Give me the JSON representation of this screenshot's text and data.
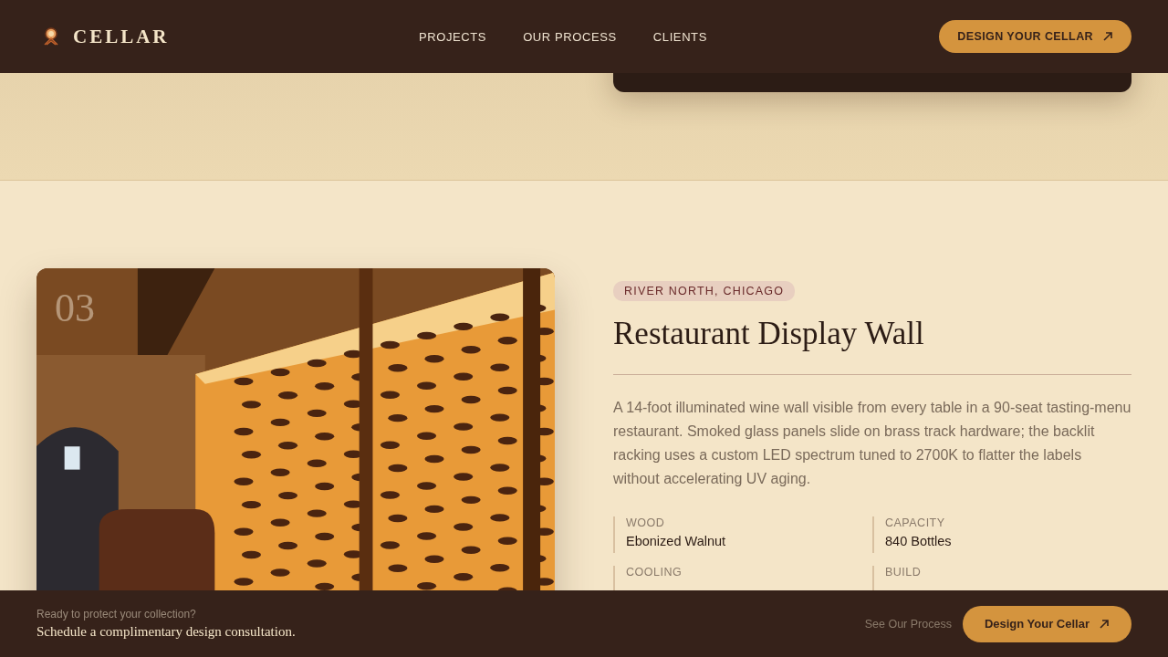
{
  "nav": {
    "brand": "CELLAR",
    "links": [
      {
        "label": "PROJECTS"
      },
      {
        "label": "OUR PROCESS"
      },
      {
        "label": "CLIENTS"
      }
    ],
    "cta": "DESIGN YOUR CELLAR"
  },
  "project": {
    "number": "03",
    "location": "RIVER NORTH, CHICAGO",
    "title": "Restaurant Display Wall",
    "description": "A 14-foot illuminated wine wall visible from every table in a 90-seat tasting-menu restaurant. Smoked glass panels slide on brass track hardware; the backlit racking uses a custom LED spectrum tuned to 2700K to flatter the labels without accelerating UV aging.",
    "specs": [
      {
        "label": "WOOD",
        "value": "Ebonized Walnut"
      },
      {
        "label": "CAPACITY",
        "value": "840 Bottles"
      },
      {
        "label": "COOLING"
      },
      {
        "label": "BUILD"
      }
    ]
  },
  "footer_bar": {
    "eyebrow": "Ready to protect your collection?",
    "headline": "Schedule a complimentary design consultation.",
    "secondary_link": "See Our Process",
    "cta": "Design Your Cellar"
  }
}
